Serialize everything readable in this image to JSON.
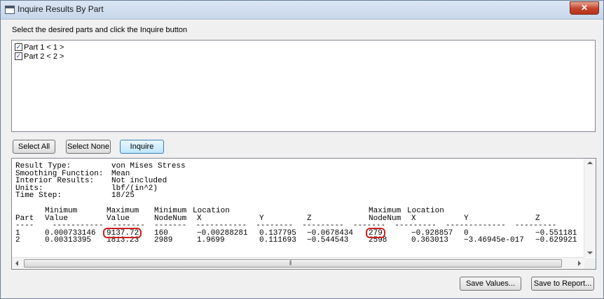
{
  "window": {
    "title": "Inquire Results By Part",
    "close_glyph": "✕"
  },
  "instruction": "Select the desired parts and click the Inquire button",
  "parts": [
    {
      "label": "Part 1 < 1 >",
      "checked": true
    },
    {
      "label": "Part 2 < 2 >",
      "checked": true
    }
  ],
  "buttons": {
    "select_all": "Select All",
    "select_none": "Select None",
    "inquire": "Inquire",
    "save_values": "Save Values...",
    "save_report": "Save to Report..."
  },
  "summary": [
    {
      "label": "Result Type:",
      "value": "von Mises Stress"
    },
    {
      "label": "Smoothing Function:",
      "value": "Mean"
    },
    {
      "label": "Interior Results:",
      "value": "Not included"
    },
    {
      "label": "Units:",
      "value": "lbf/(in^2)"
    },
    {
      "label": "Time Step:",
      "value": "18/25"
    }
  ],
  "table": {
    "head1": [
      "",
      "Minimum",
      "Maximum",
      "Minimum",
      "Location",
      "",
      "",
      "Maximum",
      "Location",
      "",
      ""
    ],
    "head2": [
      "Part",
      "Value",
      "Value",
      "NodeNum",
      "X",
      "Y",
      "Z",
      "NodeNum",
      "X",
      "Y",
      "Z"
    ],
    "rows": [
      [
        "1",
        "0.000733146",
        "9137.72",
        "160",
        "−0.00288281",
        "0.137795",
        "−0.0678434",
        "279",
        "−0.928857",
        "0",
        "−0.551181"
      ],
      [
        "2",
        "0.00313395",
        "1813.23",
        "2989",
        "1.9699",
        "0.111693",
        "−0.544543",
        "2598",
        "0.363013",
        "−3.46945e-017",
        "−0.629921"
      ]
    ]
  },
  "highlights": [
    "max-value-part1",
    "max-nodenum-part1"
  ],
  "colors": {
    "highlight": "#cc1f1f",
    "close_button": "#c4432b",
    "default_button_border": "#3c7fb1"
  }
}
